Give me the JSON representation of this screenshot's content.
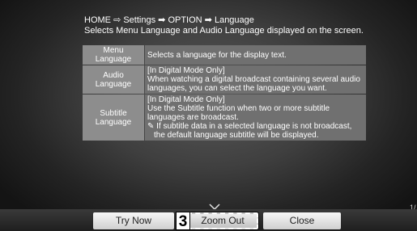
{
  "header": {
    "crumb_home": "HOME",
    "crumb_sep1": "⇨",
    "crumb_settings": "Settings",
    "crumb_sep2": "➡",
    "crumb_option": "OPTION",
    "crumb_sep3": "➡",
    "crumb_language": "Language",
    "description": "Selects Menu Language and Audio Language displayed on the screen."
  },
  "rows": [
    {
      "label": "Menu Language",
      "lines": [
        "Selects a language for the display text."
      ]
    },
    {
      "label": "Audio Language",
      "lines": [
        "[In Digital Mode Only]",
        "When watching a digital broadcast containing several audio languages, you can select the language you want."
      ]
    },
    {
      "label_line1": "Subtitle",
      "label_line2": "Language",
      "lines": [
        "[In Digital Mode Only]",
        "Use the Subtitle function when two or more subtitle languages are broadcast."
      ],
      "note": "✎ If subtitle data in a selected language is not broadcast, the default language subtitle will be displayed."
    }
  ],
  "buttons": {
    "try_now": "Try Now",
    "zoom_out": "Zoom Out",
    "close": "Close"
  },
  "badge": "3",
  "page_indicator": "1/",
  "icons": {
    "chevron": "chevron-down-icon"
  }
}
